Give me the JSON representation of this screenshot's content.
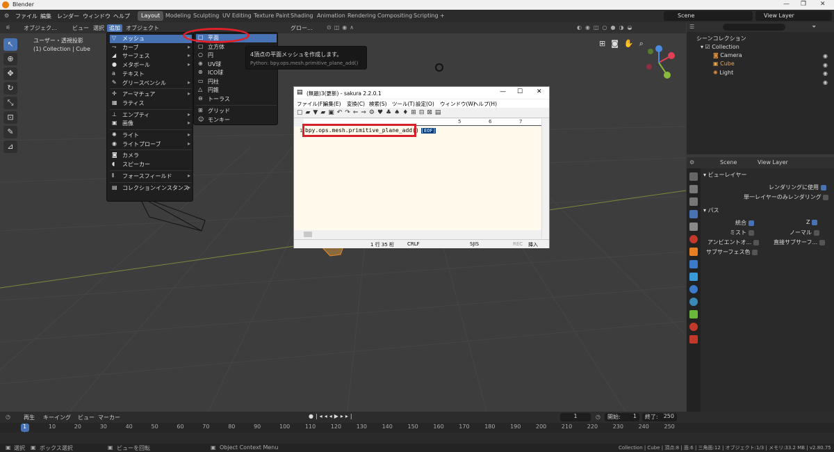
{
  "window": {
    "title": "Blender",
    "min": "—",
    "max": "❐",
    "close": "✕"
  },
  "menubar": {
    "items": [
      "ファイル",
      "編集",
      "レンダー",
      "ウィンドウ",
      "ヘルプ"
    ],
    "workspaces": [
      "Layout",
      "Modeling",
      "Sculpting",
      "UV Editing",
      "Texture Paint",
      "Shading",
      "Animation",
      "Rendering",
      "Compositing",
      "Scripting",
      "+"
    ],
    "scene": "Scene",
    "view_layer": "View Layer"
  },
  "viewport_header": {
    "mode": "オブジェク...",
    "items": [
      "ビュー",
      "選択",
      "追加",
      "オブジェクト"
    ],
    "orientation": "グロー...",
    "info_line1": "ユーザー・透視投影",
    "info_line2": "(1) Collection | Cube"
  },
  "add_menu": [
    {
      "label": "メッシュ",
      "icon": "▽",
      "arrow": "▸"
    },
    {
      "label": "カーブ",
      "icon": "⤳",
      "arrow": "▸"
    },
    {
      "label": "サーフェス",
      "icon": "◢",
      "arrow": "▸"
    },
    {
      "label": "メタボール",
      "icon": "●",
      "arrow": "▸"
    },
    {
      "label": "テキスト",
      "icon": "a",
      "arrow": ""
    },
    {
      "label": "グリースペンシル",
      "icon": "✎",
      "arrow": "▸"
    },
    {
      "label": "アーマチュア",
      "icon": "✛",
      "arrow": "▸"
    },
    {
      "label": "ラティス",
      "icon": "▦",
      "arrow": ""
    },
    {
      "label": "エンプティ",
      "icon": "⊥",
      "arrow": "▸"
    },
    {
      "label": "画像",
      "icon": "▣",
      "arrow": "▸"
    },
    {
      "label": "ライト",
      "icon": "✺",
      "arrow": "▸"
    },
    {
      "label": "ライトプローブ",
      "icon": "◉",
      "arrow": "▸"
    },
    {
      "label": "カメラ",
      "icon": "◙",
      "arrow": ""
    },
    {
      "label": "スピーカー",
      "icon": "◖",
      "arrow": ""
    },
    {
      "label": "フォースフィールド",
      "icon": "⦀",
      "arrow": "▸"
    },
    {
      "label": "コレクションインスタンス",
      "icon": "▤",
      "arrow": "▸"
    }
  ],
  "mesh_menu": [
    {
      "label": "平面",
      "icon": "□"
    },
    {
      "label": "立方体",
      "icon": "▢"
    },
    {
      "label": "円",
      "icon": "○"
    },
    {
      "label": "UV球",
      "icon": "⊕"
    },
    {
      "label": "ICO球",
      "icon": "⊛"
    },
    {
      "label": "円柱",
      "icon": "▭"
    },
    {
      "label": "円錐",
      "icon": "△"
    },
    {
      "label": "トーラス",
      "icon": "⊖"
    },
    {
      "label": "グリッド",
      "icon": "⊞"
    },
    {
      "label": "モンキー",
      "icon": "☺"
    }
  ],
  "tooltip": {
    "line1": "4頂点の平面メッシュを作成します。",
    "line2": "Python: bpy.ops.mesh.primitive_plane_add()"
  },
  "sakura": {
    "title": "(無題)3(更新) - sakura 2.2.0.1",
    "menu": [
      "ファイル(F)",
      "編集(E)",
      "変換(C)",
      "検索(S)",
      "ツール(T)",
      "設定(O)",
      "ウィンドウ(W)",
      "ヘルプ(H)"
    ],
    "ruler": [
      "5",
      "6",
      "7"
    ],
    "line_no": "1",
    "code": "bpy.ops.mesh.primitive_plane_add()",
    "eof": "[EOF]",
    "status": {
      "pos": "1 行  35 桁",
      "eol": "CRLF",
      "enc": "SJIS",
      "rec": "REC",
      "ins": "挿入"
    }
  },
  "outliner": {
    "root": "シーンコレクション",
    "collection": "Collection",
    "items": [
      "Camera",
      "Cube",
      "Light"
    ]
  },
  "properties": {
    "scene": "Scene",
    "view_layer": "View Layer",
    "section1": "ビューレイヤー",
    "use_render": "レンダリングに使用",
    "single_layer": "単一レイヤーのみレンダリング",
    "section2": "パス",
    "passes": [
      {
        "left": "統合",
        "left_on": true,
        "right": "Z",
        "right_on": true
      },
      {
        "left": "ミスト",
        "left_on": false,
        "right": "ノーマル",
        "right_on": false
      },
      {
        "left": "アンビエントオ...",
        "left_on": false,
        "right": "直接サブサーフ...",
        "right_on": false
      },
      {
        "left": "サブサーフェス色",
        "left_on": false,
        "right": "",
        "right_on": false
      }
    ]
  },
  "timeline": {
    "items": [
      "再生",
      "キーイング",
      "ビュー",
      "マーカー"
    ],
    "frames": [
      "1",
      "10",
      "20",
      "30",
      "40",
      "50",
      "60",
      "70",
      "80",
      "90",
      "100",
      "110",
      "120",
      "130",
      "140",
      "150",
      "160",
      "170",
      "180",
      "190",
      "200",
      "210",
      "220",
      "230",
      "240",
      "250"
    ],
    "current": "1",
    "start_label": "開始:",
    "start": "1",
    "end_label": "終了:",
    "end": "250"
  },
  "statusbar": {
    "select": "選択",
    "box": "ボックス選択",
    "rotate": "ビューを回転",
    "context": "Object Context Menu",
    "info": "Collection | Cube | 頂点:8 | 面:6 | 三角面:12 | オブジェクト:1/3 | メモリ:33.2 MB | v2.80.75"
  }
}
